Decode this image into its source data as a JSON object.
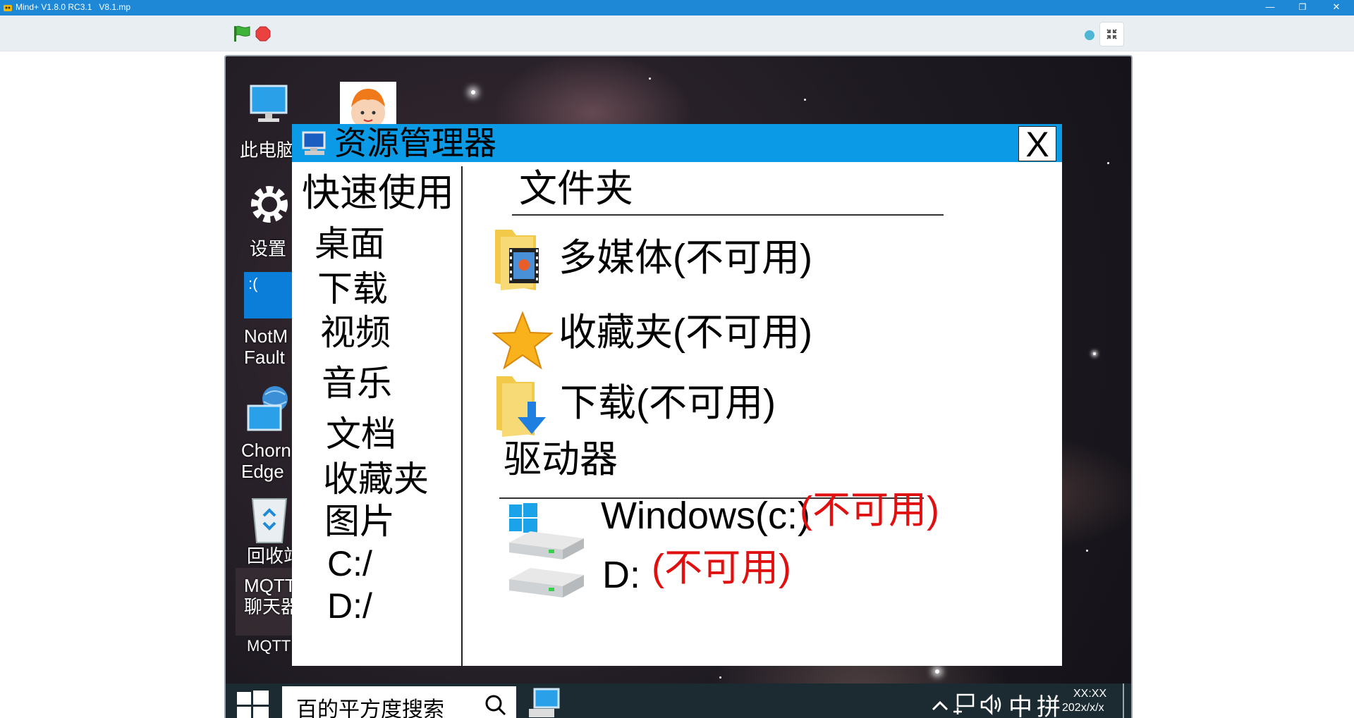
{
  "window": {
    "title": "Mind+ V1.8.0 RC3.1   V8.1.mp",
    "minimize": "—",
    "restore": "❐",
    "close": "✕"
  },
  "toolbar": {
    "flag_icon": "green-flag-icon",
    "stop_icon": "stop-icon",
    "fullscreen_icon": "fullscreen-exit-icon"
  },
  "desktop": {
    "icons": [
      {
        "label": "此电脑",
        "icon": "computer-icon"
      },
      {
        "label": "设置",
        "icon": "gear-icon"
      },
      {
        "label": "NotM\nFault",
        "icon": "sad-face-icon"
      },
      {
        "label": "Chorn\nEdge",
        "icon": "globe-computer-icon"
      },
      {
        "label": "回收站",
        "icon": "recycle-bin-icon"
      },
      {
        "label": "MQTT\n聊天器",
        "icon": "chat-icon"
      },
      {
        "label": "MQTT",
        "icon": "mqtt-icon"
      }
    ]
  },
  "explorer": {
    "title": "资源管理器",
    "close_label": "X",
    "sidebar": {
      "heading": "快速使用",
      "items": [
        "桌面",
        "下载",
        "视频",
        "音乐",
        "文档",
        "收藏夹",
        "图片",
        "C:/",
        "D:/"
      ]
    },
    "folders": {
      "heading": "文件夹",
      "items": [
        {
          "label": "多媒体(不可用)",
          "icon": "multimedia-folder-icon"
        },
        {
          "label": "收藏夹(不可用)",
          "icon": "star-icon"
        },
        {
          "label": "下载(不可用)",
          "icon": "download-folder-icon"
        }
      ]
    },
    "drives": {
      "heading": "驱动器",
      "items": [
        {
          "name": "Windows(c:)",
          "status": "(不可用)",
          "icon": "windows-drive-icon"
        },
        {
          "name": "D:",
          "status": "(不可用)",
          "icon": "drive-icon"
        }
      ]
    }
  },
  "taskbar": {
    "search_text": "百的平方度搜索",
    "tray": {
      "ime": "中",
      "ime2": "拼",
      "time": "XX:XX",
      "date": "202x/x/x"
    }
  },
  "colors": {
    "app_titlebar": "#1e88d6",
    "explorer_titlebar": "#0a9ae6",
    "unavailable_red": "#e01010",
    "taskbar": "#1c2a32"
  }
}
